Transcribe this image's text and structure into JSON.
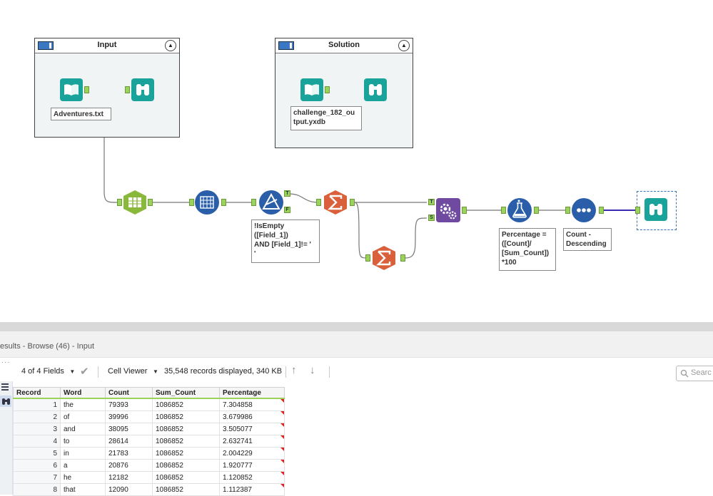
{
  "canvas": {
    "containers": {
      "input": {
        "title": "Input"
      },
      "solution": {
        "title": "Solution"
      }
    },
    "annotations": {
      "adventures": "Adventures.txt",
      "solution_output": "challenge_182_ou\ntput.yxdb",
      "filter": "!IsEmpty\n([Field_1])\nAND [Field_1]!= '\n'",
      "formula": "Percentage =\n([Count]/\n[Sum_Count])\n*100",
      "sort": "Count -\nDescending"
    },
    "anchors": {
      "true": "T",
      "false": "F",
      "join_t": "T",
      "join_s": "S"
    },
    "tool_colors": {
      "input": "#1aa39a",
      "browse": "#1aa39a",
      "text_to_columns": "#8ab83a",
      "tokenize": "#2a5ea8",
      "filter": "#2a5ea8",
      "summarize": "#d9603b",
      "append": "#6f4aa0",
      "formula": "#2a5ea8",
      "sort": "#2a5ea8"
    },
    "wire_color": "#777777",
    "selected_wire_color": "#3a2ab0"
  },
  "results": {
    "title": "esults - Browse (46) - Input",
    "toolbar": {
      "fields": "4 of 4 Fields",
      "cell_viewer": "Cell Viewer",
      "records": "35,548 records displayed, 340 KB"
    },
    "search_placeholder": "Searc",
    "columns": [
      "Record",
      "Word",
      "Count",
      "Sum_Count",
      "Percentage"
    ],
    "rows": [
      {
        "record": "1",
        "word": "the",
        "count": "79393",
        "sum_count": "1086852",
        "percentage": "7.304858"
      },
      {
        "record": "2",
        "word": "of",
        "count": "39996",
        "sum_count": "1086852",
        "percentage": "3.679986"
      },
      {
        "record": "3",
        "word": "and",
        "count": "38095",
        "sum_count": "1086852",
        "percentage": "3.505077"
      },
      {
        "record": "4",
        "word": "to",
        "count": "28614",
        "sum_count": "1086852",
        "percentage": "2.632741"
      },
      {
        "record": "5",
        "word": "in",
        "count": "21783",
        "sum_count": "1086852",
        "percentage": "2.004229"
      },
      {
        "record": "6",
        "word": "a",
        "count": "20876",
        "sum_count": "1086852",
        "percentage": "1.920777"
      },
      {
        "record": "7",
        "word": "he",
        "count": "12182",
        "sum_count": "1086852",
        "percentage": "1.120852"
      },
      {
        "record": "8",
        "word": "that",
        "count": "12090",
        "sum_count": "1086852",
        "percentage": "1.112387"
      }
    ]
  }
}
